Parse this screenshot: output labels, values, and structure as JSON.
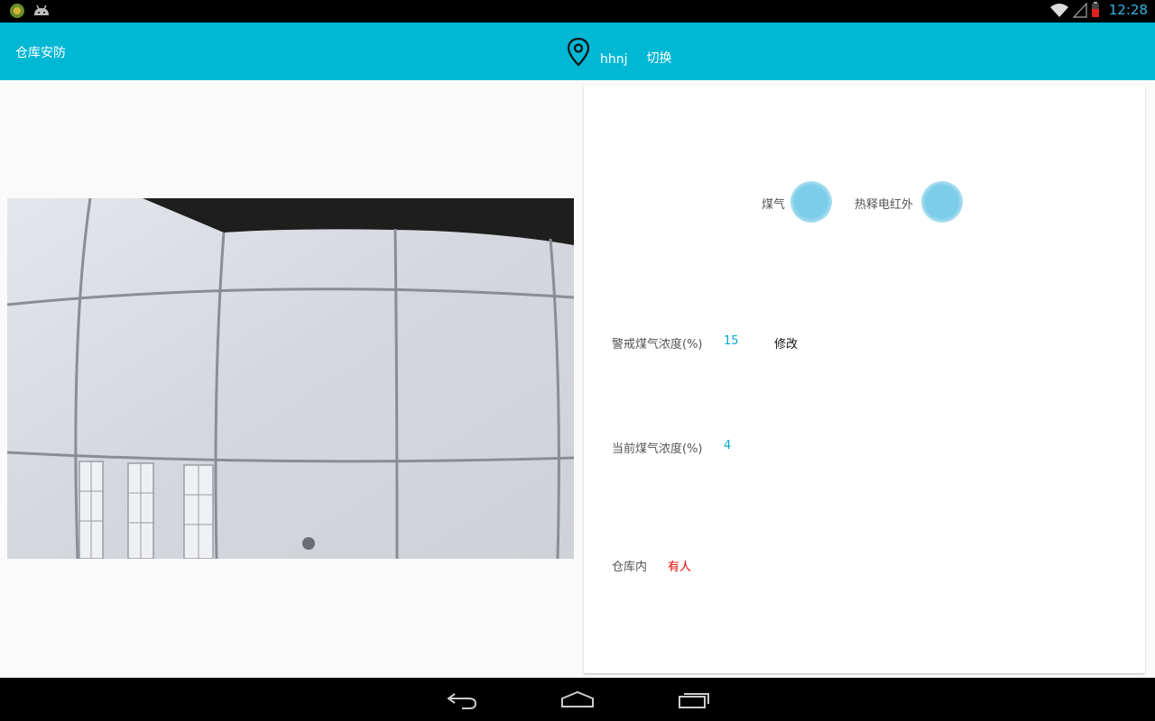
{
  "status_bar": {
    "time": "12:28",
    "icons": [
      "app-notification-icon",
      "android-icon",
      "wifi-icon",
      "signal-icon",
      "battery-icon"
    ]
  },
  "app_bar": {
    "title": "仓库安防",
    "location_icon": "location-pin-icon",
    "location_name": "hhnj",
    "switch_label": "切换"
  },
  "panel": {
    "gas_label": "煤气",
    "pir_label": "热释电红外",
    "alert_gas_label": "警戒煤气浓度(%)",
    "alert_gas_value": "15",
    "modify_label": "修改",
    "current_gas_label": "当前煤气浓度(%)",
    "current_gas_value": "4",
    "warehouse_label": "仓库内",
    "warehouse_status": "有人"
  },
  "colors": {
    "accent": "#00b7d4",
    "indicator": "#7ccde9",
    "value_text": "#00a8cc",
    "alert_text": "#ee0000"
  },
  "nav_bar": {
    "icons": [
      "back-icon",
      "home-icon",
      "recents-icon"
    ]
  }
}
